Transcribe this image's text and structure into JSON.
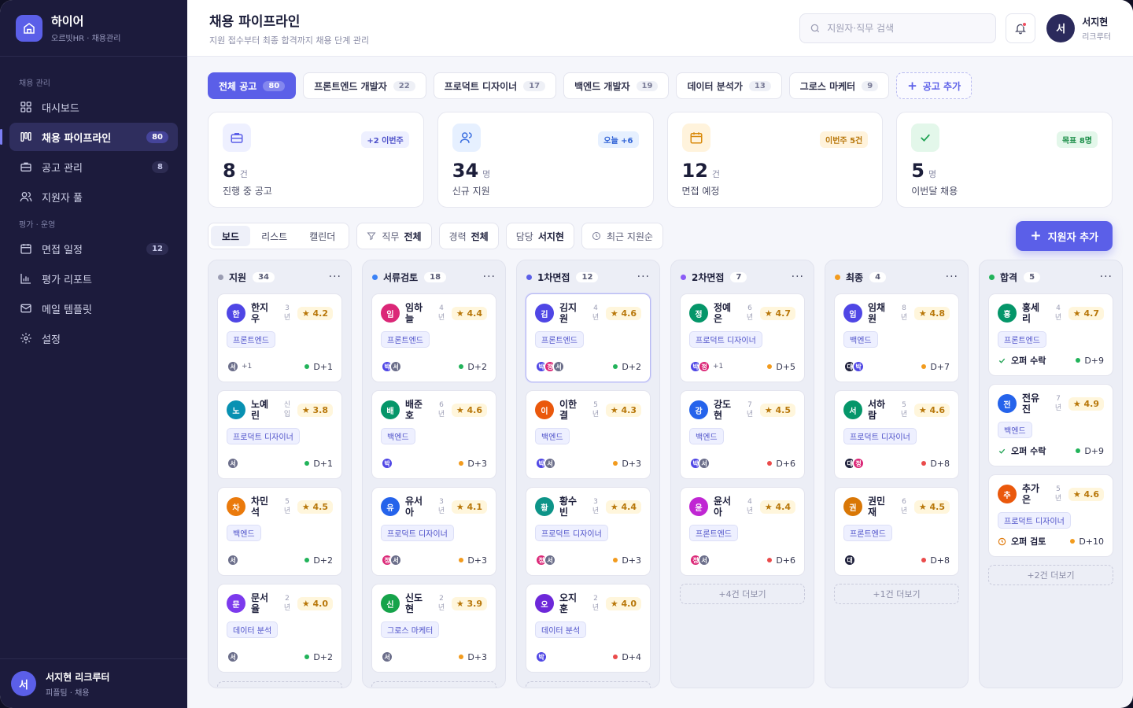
{
  "brand": {
    "name": "하이어",
    "sub": "오르빗HR · 채용관리"
  },
  "nav": {
    "section1": "채용 관리",
    "section2": "평가 · 운영",
    "items": [
      {
        "label": "대시보드",
        "count": ""
      },
      {
        "label": "채용 파이프라인",
        "count": "80"
      },
      {
        "label": "공고 관리",
        "count": "8"
      },
      {
        "label": "지원자 풀",
        "count": ""
      },
      {
        "label": "면접 일정",
        "count": "12"
      },
      {
        "label": "평가 리포트",
        "count": ""
      },
      {
        "label": "메일 템플릿",
        "count": ""
      },
      {
        "label": "설정",
        "count": ""
      }
    ]
  },
  "sidebar_user": {
    "initial": "서",
    "name": "서지현 리크루터",
    "role": "피플팀 · 채용"
  },
  "header": {
    "title": "채용 파이프라인",
    "subtitle": "지원 접수부터 최종 합격까지 채용 단계 관리",
    "search_placeholder": "지원자·직무 검색",
    "user_initial": "서",
    "user_name": "서지현",
    "user_role": "리크루터"
  },
  "tabs": [
    {
      "label": "전체 공고",
      "count": "80"
    },
    {
      "label": "프론트엔드 개발자",
      "count": "22"
    },
    {
      "label": "프로덕트 디자이너",
      "count": "17"
    },
    {
      "label": "백엔드 개발자",
      "count": "19"
    },
    {
      "label": "데이터 분석가",
      "count": "13"
    },
    {
      "label": "그로스 마케터",
      "count": "9"
    }
  ],
  "add_tab_label": "공고 추가",
  "stats": [
    {
      "value": "8",
      "unit": "건",
      "label": "진행 중 공고",
      "badge": "+2 이번주",
      "icon": "briefcase-icon"
    },
    {
      "value": "34",
      "unit": "명",
      "label": "신규 지원",
      "badge": "오늘 +6",
      "icon": "users-icon"
    },
    {
      "value": "12",
      "unit": "건",
      "label": "면접 예정",
      "badge": "이번주 5건",
      "icon": "calendar-icon"
    },
    {
      "value": "5",
      "unit": "명",
      "label": "이번달 채용",
      "badge": "목표 8명",
      "icon": "check-icon"
    }
  ],
  "toolbar": {
    "views": [
      "보드",
      "리스트",
      "캘린더"
    ],
    "filters": [
      {
        "label": "직무",
        "value": "전체"
      },
      {
        "label": "경력",
        "value": "전체"
      },
      {
        "label": "담당",
        "value": "서지현"
      }
    ],
    "sort": "최근 지원순",
    "add_label": "지원자 추가"
  },
  "colors": {
    "accent": "#5b5fe8",
    "sidebar": "#1c1b3c",
    "due_green": "#22b35a",
    "due_orange": "#f29b1e",
    "due_red": "#ea4b4b"
  },
  "columns": [
    {
      "title": "지원",
      "count": "34",
      "dot": "#9a9cb2",
      "more": "",
      "cards": [
        {
          "initial": "한",
          "name": "한지우",
          "years": "3년",
          "rating": "★ 4.2",
          "tag": "프론트엔드",
          "avatars": [
            "서"
          ],
          "extra": "+1",
          "due": "D+1",
          "due_color": "#22b35a",
          "av": "#4f46e5"
        },
        {
          "initial": "노",
          "name": "노예린",
          "years": "신입",
          "rating": "★ 3.8",
          "tag": "프로덕트 디자이너",
          "avatars": [
            "서"
          ],
          "extra": "",
          "due": "D+1",
          "due_color": "#22b35a",
          "av": "#0891b2"
        },
        {
          "initial": "차",
          "name": "차민석",
          "years": "5년",
          "rating": "★ 4.5",
          "tag": "백엔드",
          "avatars": [
            "서"
          ],
          "extra": "",
          "due": "D+2",
          "due_color": "#22b35a",
          "av": "#ea7a0c"
        },
        {
          "initial": "문",
          "name": "문서율",
          "years": "2년",
          "rating": "★ 4.0",
          "tag": "데이터 분석",
          "avatars": [
            "서"
          ],
          "extra": "",
          "due": "D+2",
          "due_color": "#22b35a",
          "av": "#7c3aed"
        }
      ]
    },
    {
      "title": "서류검토",
      "count": "18",
      "dot": "#3b82f6",
      "more": "",
      "cards": [
        {
          "initial": "임",
          "name": "임하늘",
          "years": "4년",
          "rating": "★ 4.4",
          "tag": "프론트엔드",
          "avatars": [
            "박",
            "서"
          ],
          "extra": "",
          "due": "D+2",
          "due_color": "#22b35a",
          "av": "#db2777"
        },
        {
          "initial": "배",
          "name": "배준호",
          "years": "6년",
          "rating": "★ 4.6",
          "tag": "백엔드",
          "avatars": [
            "박"
          ],
          "extra": "",
          "due": "D+3",
          "due_color": "#f29b1e",
          "av": "#059669"
        },
        {
          "initial": "유",
          "name": "유서아",
          "years": "3년",
          "rating": "★ 4.1",
          "tag": "프로덕트 디자이너",
          "avatars": [
            "정",
            "서"
          ],
          "extra": "",
          "due": "D+3",
          "due_color": "#f29b1e",
          "av": "#2563eb"
        },
        {
          "initial": "신",
          "name": "신도현",
          "years": "2년",
          "rating": "★ 3.9",
          "tag": "그로스 마케터",
          "avatars": [
            "서"
          ],
          "extra": "",
          "due": "D+3",
          "due_color": "#f29b1e",
          "av": "#16a34a"
        }
      ]
    },
    {
      "title": "1차면접",
      "count": "12",
      "dot": "#5b5fe8",
      "more": "",
      "cards": [
        {
          "initial": "김",
          "name": "김지원",
          "years": "4년",
          "rating": "★ 4.6",
          "tag": "프론트엔드",
          "avatars": [
            "박",
            "정",
            "서"
          ],
          "extra": "",
          "due": "D+2",
          "due_color": "#22b35a",
          "av": "#4f46e5"
        },
        {
          "initial": "이",
          "name": "이한결",
          "years": "5년",
          "rating": "★ 4.3",
          "tag": "백엔드",
          "avatars": [
            "박",
            "서"
          ],
          "extra": "",
          "due": "D+3",
          "due_color": "#f29b1e",
          "av": "#ea580c"
        },
        {
          "initial": "황",
          "name": "황수빈",
          "years": "3년",
          "rating": "★ 4.4",
          "tag": "프로덕트 디자이너",
          "avatars": [
            "정",
            "서"
          ],
          "extra": "",
          "due": "D+3",
          "due_color": "#f29b1e",
          "av": "#0d9488"
        },
        {
          "initial": "오",
          "name": "오지훈",
          "years": "2년",
          "rating": "★ 4.0",
          "tag": "데이터 분석",
          "avatars": [
            "박"
          ],
          "extra": "",
          "due": "D+4",
          "due_color": "#ea4b4b",
          "av": "#6d28d9"
        }
      ]
    },
    {
      "title": "2차면접",
      "count": "7",
      "dot": "#8b5cf6",
      "more": "+4건 더보기",
      "cards": [
        {
          "initial": "정",
          "name": "정예은",
          "years": "6년",
          "rating": "★ 4.7",
          "tag": "프로덕트 디자이너",
          "avatars": [
            "박",
            "정"
          ],
          "extra": "+1",
          "due": "D+5",
          "due_color": "#f29b1e",
          "av": "#059669"
        },
        {
          "initial": "강",
          "name": "강도현",
          "years": "7년",
          "rating": "★ 4.5",
          "tag": "백엔드",
          "avatars": [
            "박",
            "서"
          ],
          "extra": "",
          "due": "D+6",
          "due_color": "#ea4b4b",
          "av": "#2563eb"
        },
        {
          "initial": "윤",
          "name": "윤서아",
          "years": "4년",
          "rating": "★ 4.4",
          "tag": "프론트엔드",
          "avatars": [
            "정",
            "서"
          ],
          "extra": "",
          "due": "D+6",
          "due_color": "#ea4b4b",
          "av": "#c026d3"
        }
      ]
    },
    {
      "title": "최종",
      "count": "4",
      "dot": "#f29b1e",
      "more": "+1건 더보기",
      "cards": [
        {
          "initial": "임",
          "name": "임채원",
          "years": "8년",
          "rating": "★ 4.8",
          "tag": "백엔드",
          "avatars": [
            "대",
            "박"
          ],
          "extra": "",
          "due": "D+7",
          "due_color": "#f29b1e",
          "av": "#4f46e5"
        },
        {
          "initial": "서",
          "name": "서하람",
          "years": "5년",
          "rating": "★ 4.6",
          "tag": "프로덕트 디자이너",
          "avatars": [
            "대",
            "정"
          ],
          "extra": "",
          "due": "D+8",
          "due_color": "#ea4b4b",
          "av": "#059669"
        },
        {
          "initial": "권",
          "name": "권민재",
          "years": "6년",
          "rating": "★ 4.5",
          "tag": "프론트엔드",
          "avatars": [
            "대"
          ],
          "extra": "",
          "due": "D+8",
          "due_color": "#ea4b4b",
          "av": "#d97706"
        }
      ]
    },
    {
      "title": "합격",
      "count": "5",
      "dot": "#22b35a",
      "more": "+2건 더보기",
      "cards": [
        {
          "initial": "홍",
          "name": "홍세리",
          "years": "4년",
          "rating": "★ 4.7",
          "tag": "프론트엔드",
          "offer": "오퍼 수락",
          "offer_kind": "check",
          "due": "D+9",
          "due_color": "#22b35a",
          "av": "#059669"
        },
        {
          "initial": "전",
          "name": "전유진",
          "years": "7년",
          "rating": "★ 4.9",
          "tag": "백엔드",
          "offer": "오퍼 수락",
          "offer_kind": "check",
          "due": "D+9",
          "due_color": "#22b35a",
          "av": "#2563eb"
        },
        {
          "initial": "추",
          "name": "추가은",
          "years": "5년",
          "rating": "★ 4.6",
          "tag": "프로덕트 디자이너",
          "offer": "오퍼 검토",
          "offer_kind": "clock",
          "due": "D+10",
          "due_color": "#f29b1e",
          "av": "#ea580c"
        }
      ]
    }
  ]
}
